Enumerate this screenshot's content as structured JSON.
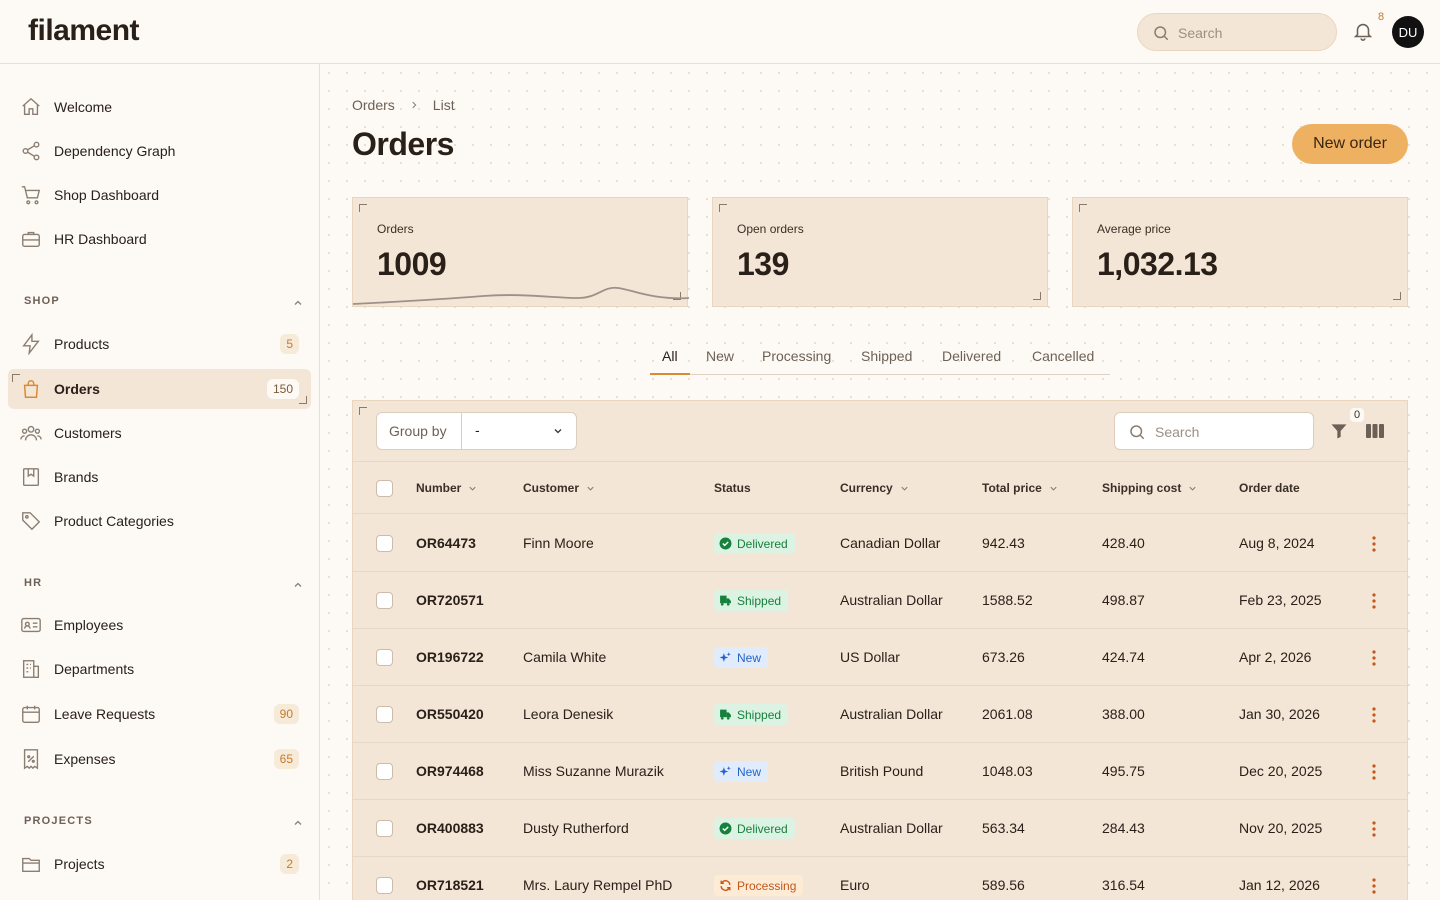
{
  "app": {
    "logo": "filament"
  },
  "topbar": {
    "search_placeholder": "Search",
    "notifications_count": "8",
    "avatar_initials": "DU"
  },
  "sidebar": {
    "top_items": [
      {
        "label": "Welcome",
        "icon": "home-icon"
      },
      {
        "label": "Dependency Graph",
        "icon": "share-icon"
      },
      {
        "label": "Shop Dashboard",
        "icon": "cart-icon"
      },
      {
        "label": "HR Dashboard",
        "icon": "briefcase-icon"
      }
    ],
    "groups": [
      {
        "title": "SHOP",
        "items": [
          {
            "label": "Products",
            "badge": "5",
            "icon": "bolt-icon"
          },
          {
            "label": "Orders",
            "badge": "150",
            "icon": "bag-icon",
            "active": true
          },
          {
            "label": "Customers",
            "badge": "",
            "icon": "users-icon"
          },
          {
            "label": "Brands",
            "badge": "",
            "icon": "bookmark-icon"
          },
          {
            "label": "Product Categories",
            "badge": "",
            "icon": "tag-icon"
          }
        ]
      },
      {
        "title": "HR",
        "items": [
          {
            "label": "Employees",
            "badge": "",
            "icon": "id-card-icon"
          },
          {
            "label": "Departments",
            "badge": "",
            "icon": "building-icon"
          },
          {
            "label": "Leave Requests",
            "badge": "90",
            "icon": "calendar-icon"
          },
          {
            "label": "Expenses",
            "badge": "65",
            "icon": "receipt-icon"
          }
        ]
      },
      {
        "title": "PROJECTS",
        "items": [
          {
            "label": "Projects",
            "badge": "2",
            "icon": "folder-icon"
          }
        ]
      }
    ]
  },
  "breadcrumb": {
    "parent": "Orders",
    "current": "List"
  },
  "page": {
    "title": "Orders",
    "new_button": "New order"
  },
  "stats": [
    {
      "label": "Orders",
      "value": "1009"
    },
    {
      "label": "Open orders",
      "value": "139"
    },
    {
      "label": "Average price",
      "value": "1,032.13"
    }
  ],
  "tabs": [
    "All",
    "New",
    "Processing",
    "Shipped",
    "Delivered",
    "Cancelled"
  ],
  "active_tab": "All",
  "table": {
    "group_by_label": "Group by",
    "group_by_value": "-",
    "search_placeholder": "Search",
    "filter_count": "0",
    "columns": [
      "Number",
      "Customer",
      "Status",
      "Currency",
      "Total price",
      "Shipping cost",
      "Order date"
    ],
    "rows": [
      {
        "number": "OR64473",
        "customer": "Finn Moore",
        "status": "Delivered",
        "currency": "Canadian Dollar",
        "total": "942.43",
        "shipping": "428.40",
        "date": "Aug 8, 2024"
      },
      {
        "number": "OR720571",
        "customer": "",
        "status": "Shipped",
        "currency": "Australian Dollar",
        "total": "1588.52",
        "shipping": "498.87",
        "date": "Feb 23, 2025"
      },
      {
        "number": "OR196722",
        "customer": "Camila White",
        "status": "New",
        "currency": "US Dollar",
        "total": "673.26",
        "shipping": "424.74",
        "date": "Apr 2, 2026"
      },
      {
        "number": "OR550420",
        "customer": "Leora Denesik",
        "status": "Shipped",
        "currency": "Australian Dollar",
        "total": "2061.08",
        "shipping": "388.00",
        "date": "Jan 30, 2026"
      },
      {
        "number": "OR974468",
        "customer": "Miss Suzanne Murazik",
        "status": "New",
        "currency": "British Pound",
        "total": "1048.03",
        "shipping": "495.75",
        "date": "Dec 20, 2025"
      },
      {
        "number": "OR400883",
        "customer": "Dusty Rutherford",
        "status": "Delivered",
        "currency": "Australian Dollar",
        "total": "563.34",
        "shipping": "284.43",
        "date": "Nov 20, 2025"
      },
      {
        "number": "OR718521",
        "customer": "Mrs. Laury Rempel PhD",
        "status": "Processing",
        "currency": "Euro",
        "total": "589.56",
        "shipping": "316.54",
        "date": "Jan 12, 2026"
      }
    ]
  },
  "colors": {
    "accent": "#eeb162",
    "panel": "#f4e6d6",
    "badge_text": "#c77b2f"
  }
}
